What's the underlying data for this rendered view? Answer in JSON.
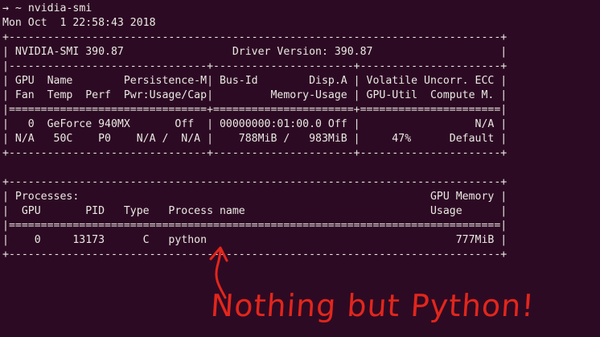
{
  "prompt": {
    "symbol": "→",
    "dir": "~",
    "command": "nvidia-smi"
  },
  "timestamp": "Mon Oct  1 22:58:43 2018",
  "output_lines": [
    "+-----------------------------------------------------------------------------+",
    "| NVIDIA-SMI 390.87                 Driver Version: 390.87                    |",
    "|-------------------------------+----------------------+----------------------+",
    "| GPU  Name        Persistence-M| Bus-Id        Disp.A | Volatile Uncorr. ECC |",
    "| Fan  Temp  Perf  Pwr:Usage/Cap|         Memory-Usage | GPU-Util  Compute M. |",
    "|===============================+======================+======================|",
    "|   0  GeForce 940MX       Off  | 00000000:01:00.0 Off |                  N/A |",
    "| N/A   50C    P0    N/A /  N/A |    788MiB /   983MiB |     47%      Default |",
    "+-------------------------------+----------------------+----------------------+",
    "",
    "+-----------------------------------------------------------------------------+",
    "| Processes:                                                       GPU Memory |",
    "|  GPU       PID   Type   Process name                             Usage      |",
    "|=============================================================================|",
    "|    0     13173      C   python                                       777MiB |",
    "+-----------------------------------------------------------------------------+"
  ],
  "annotation": {
    "text": "Nothing but Python!",
    "color": "#e2261c"
  },
  "colors": {
    "background": "#2d0a23",
    "foreground": "#e9e9e3"
  }
}
